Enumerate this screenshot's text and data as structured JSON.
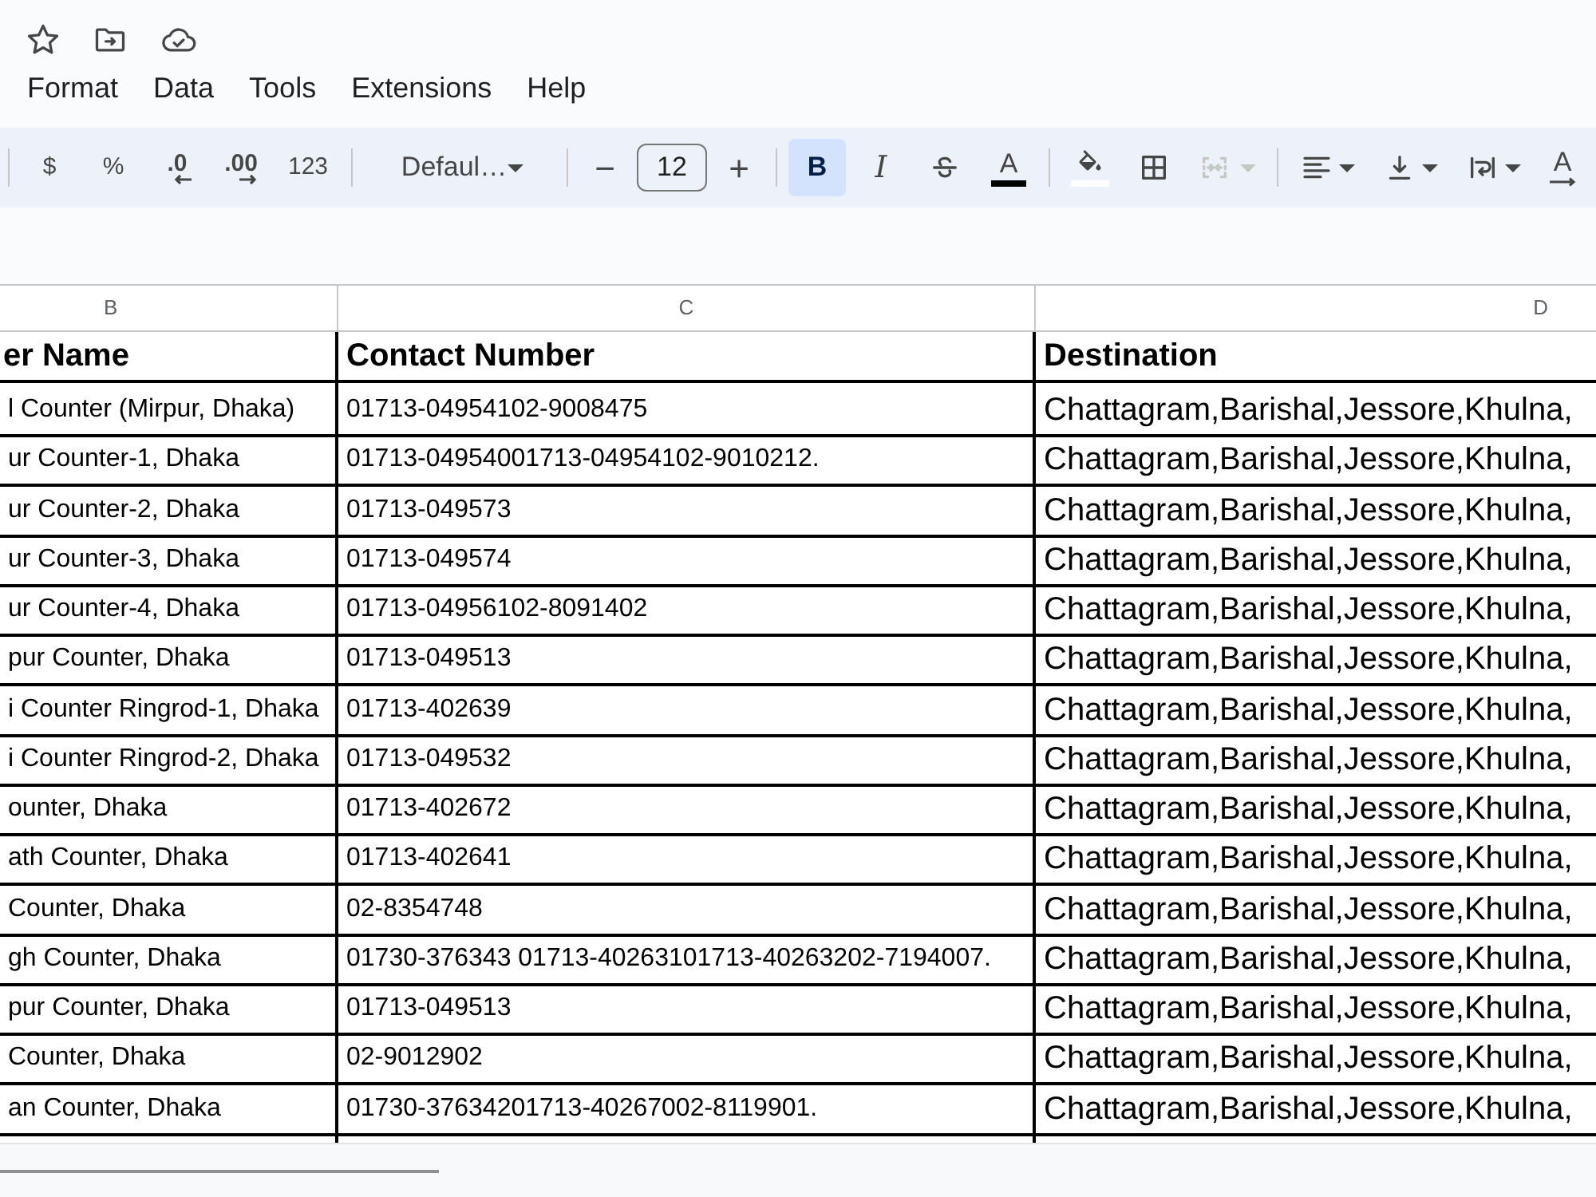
{
  "menu": [
    {
      "label": "Format"
    },
    {
      "label": "Data"
    },
    {
      "label": "Tools"
    },
    {
      "label": "Extensions"
    },
    {
      "label": "Help"
    }
  ],
  "toolbar": [
    {
      "kind": "divider"
    },
    {
      "kind": "text",
      "label": "$",
      "disabled": false
    },
    {
      "kind": "text",
      "label": "%",
      "disabled": false
    },
    {
      "kind": "decimal_decrease",
      "label": ".0",
      "disabled": false
    },
    {
      "kind": "decimal_increase",
      "label": ".00",
      "disabled": false
    },
    {
      "kind": "text",
      "label": "123",
      "disabled": false
    },
    {
      "kind": "divider"
    },
    {
      "kind": "font_select",
      "value": "Defaul…",
      "disabled": false
    },
    {
      "kind": "divider"
    },
    {
      "kind": "size",
      "minus": "−",
      "value": "12",
      "plus": "+",
      "disabled": false
    },
    {
      "kind": "divider"
    },
    {
      "kind": "bold",
      "label": "B",
      "on": true,
      "disabled": false
    },
    {
      "kind": "italic",
      "label": "I",
      "on": false,
      "disabled": false
    },
    {
      "kind": "strikethrough",
      "on": false,
      "disabled": false
    },
    {
      "kind": "text_color",
      "label": "A",
      "color": "#000000",
      "disabled": false
    },
    {
      "kind": "divider"
    },
    {
      "kind": "fill_color",
      "color": "#ffffff",
      "disabled": false
    },
    {
      "kind": "borders",
      "disabled": false
    },
    {
      "kind": "merge",
      "disabled": true
    },
    {
      "kind": "divider"
    },
    {
      "kind": "align",
      "disabled": false
    },
    {
      "kind": "valign",
      "disabled": false
    },
    {
      "kind": "wrap",
      "disabled": false
    },
    {
      "kind": "rotate",
      "label": "A",
      "disabled": false
    }
  ],
  "sheet": {
    "columns": [
      "B",
      "C",
      "D"
    ],
    "header": [
      "er Name",
      "Contact Number",
      "Destination"
    ],
    "rows": [
      [
        "l Counter (Mirpur, Dhaka)",
        "01713-04954102-9008475",
        "Chattagram,Barishal,Jessore,Khulna,"
      ],
      [
        "ur Counter-1, Dhaka",
        "01713-04954001713-04954102-9010212.",
        "Chattagram,Barishal,Jessore,Khulna,"
      ],
      [
        "ur Counter-2, Dhaka",
        "01713-049573",
        "Chattagram,Barishal,Jessore,Khulna,"
      ],
      [
        "ur Counter-3, Dhaka",
        "01713-049574",
        "Chattagram,Barishal,Jessore,Khulna,"
      ],
      [
        "ur Counter-4, Dhaka",
        "01713-04956102-8091402",
        "Chattagram,Barishal,Jessore,Khulna,"
      ],
      [
        "pur Counter, Dhaka",
        "01713-049513",
        "Chattagram,Barishal,Jessore,Khulna,"
      ],
      [
        "i Counter Ringrod-1, Dhaka",
        "01713-402639",
        "Chattagram,Barishal,Jessore,Khulna,"
      ],
      [
        "i Counter Ringrod-2, Dhaka",
        "01713-049532",
        "Chattagram,Barishal,Jessore,Khulna,"
      ],
      [
        "ounter, Dhaka",
        "01713-402672",
        "Chattagram,Barishal,Jessore,Khulna,"
      ],
      [
        "ath Counter, Dhaka",
        "01713-402641",
        "Chattagram,Barishal,Jessore,Khulna,"
      ],
      [
        "Counter, Dhaka",
        "02-8354748",
        "Chattagram,Barishal,Jessore,Khulna,"
      ],
      [
        "gh Counter, Dhaka",
        "01730-376343 01713-40263101713-40263202-7194007.",
        "Chattagram,Barishal,Jessore,Khulna,"
      ],
      [
        "pur Counter, Dhaka",
        "01713-049513",
        "Chattagram,Barishal,Jessore,Khulna,"
      ],
      [
        "Counter, Dhaka",
        "02-9012902",
        "Chattagram,Barishal,Jessore,Khulna,"
      ],
      [
        "an Counter, Dhaka",
        "01730-37634201713-40267002-8119901.",
        "Chattagram,Barishal,Jessore,Khulna,"
      ]
    ]
  }
}
